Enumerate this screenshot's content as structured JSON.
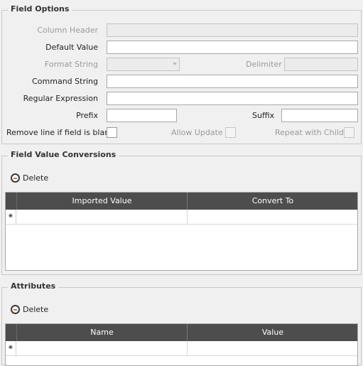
{
  "field_options": {
    "title": "Field Options",
    "column_header": {
      "label": "Column Header",
      "value": ""
    },
    "default_value": {
      "label": "Default Value",
      "value": ""
    },
    "format_string": {
      "label": "Format String",
      "value": ""
    },
    "delimiter": {
      "label": "Delimiter",
      "value": ""
    },
    "command_string": {
      "label": "Command String",
      "value": ""
    },
    "regular_expression": {
      "label": "Regular Expression",
      "value": ""
    },
    "prefix": {
      "label": "Prefix",
      "value": ""
    },
    "suffix": {
      "label": "Suffix",
      "value": ""
    },
    "remove_line": {
      "label": "Remove line if field is blank",
      "checked": false
    },
    "allow_update": {
      "label": "Allow Update",
      "checked": false
    },
    "repeat_with_child": {
      "label": "Repeat with Child",
      "checked": false
    }
  },
  "field_value_conversions": {
    "title": "Field Value Conversions",
    "delete_label": "Delete",
    "columns": [
      "Imported Value",
      "Convert To"
    ],
    "rows": []
  },
  "attributes": {
    "title": "Attributes",
    "delete_label": "Delete",
    "columns": [
      "Name",
      "Value"
    ],
    "rows": []
  },
  "new_row_glyph": "✷",
  "colors": {
    "grid_header": "#4d4d4d",
    "delete_accent": "#e26a17"
  }
}
